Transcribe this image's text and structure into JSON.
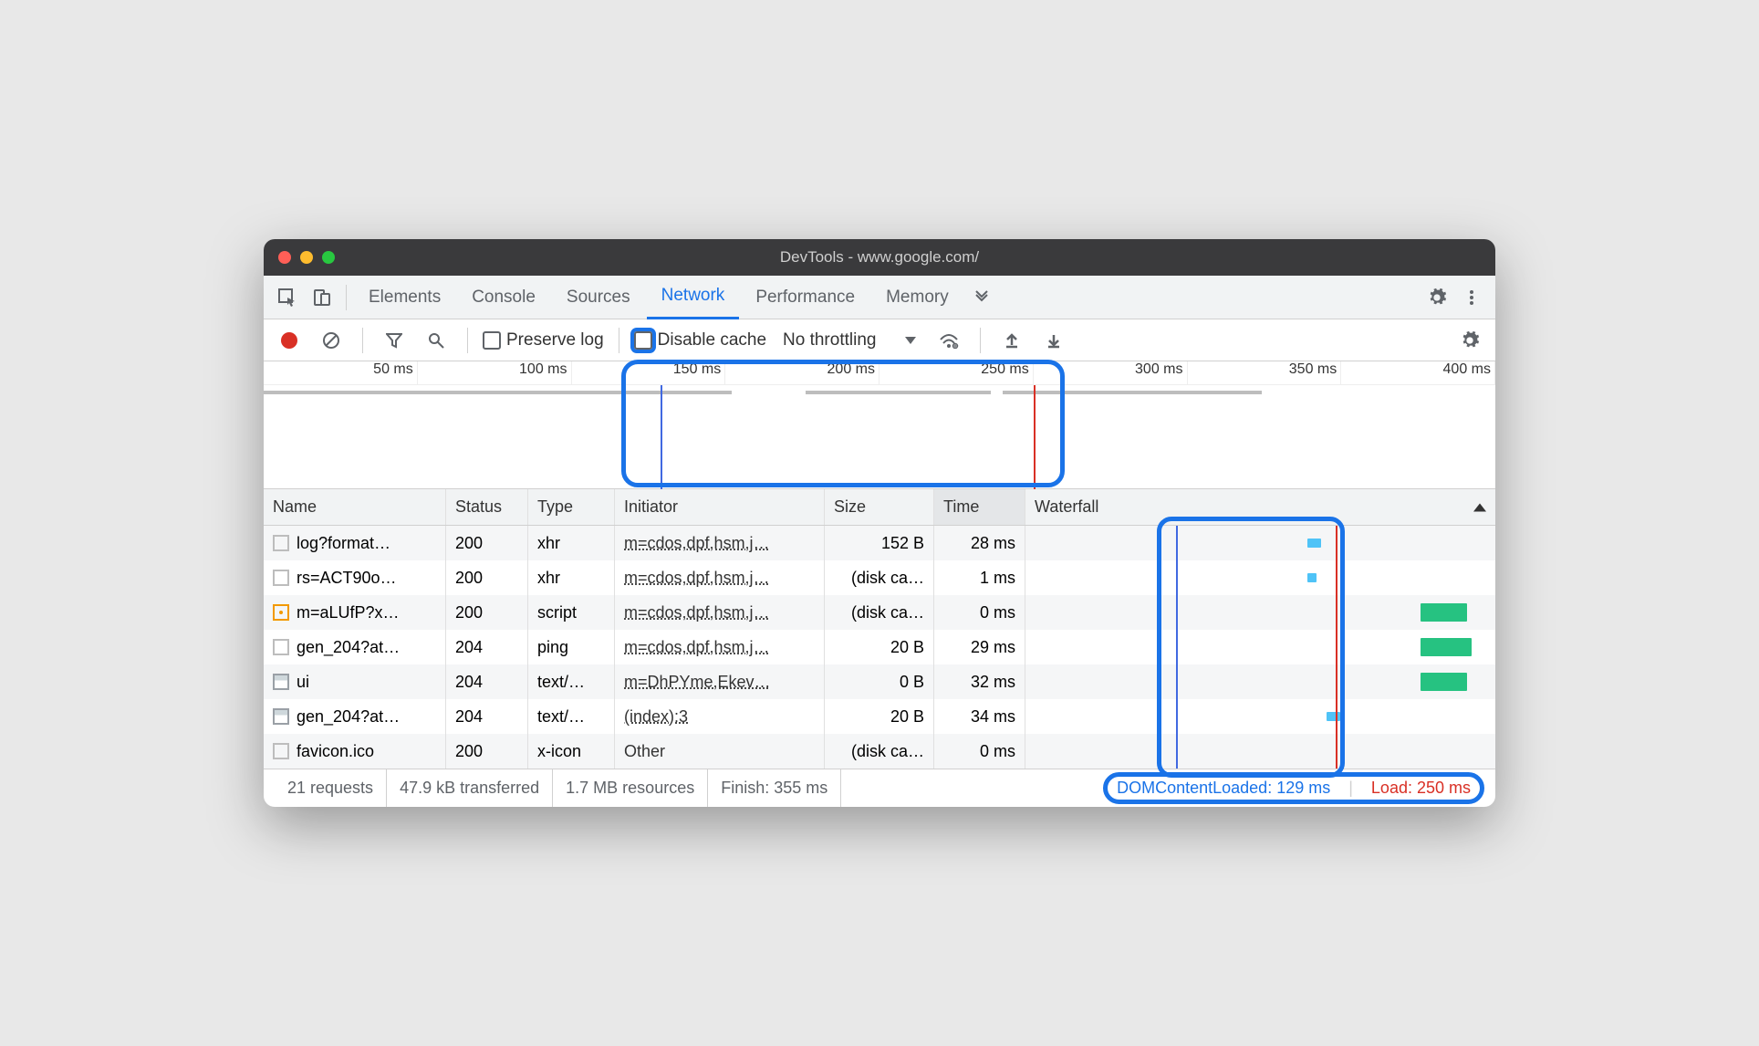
{
  "window": {
    "title": "DevTools - www.google.com/"
  },
  "tabs": [
    "Elements",
    "Console",
    "Sources",
    "Network",
    "Performance",
    "Memory"
  ],
  "activeTab": "Network",
  "toolbar": {
    "preserveLog": "Preserve log",
    "disableCache": "Disable cache",
    "throttling": "No throttling"
  },
  "timeline": {
    "ticks": [
      "50 ms",
      "100 ms",
      "150 ms",
      "200 ms",
      "250 ms",
      "300 ms",
      "350 ms",
      "400 ms"
    ]
  },
  "columns": {
    "name": "Name",
    "status": "Status",
    "type": "Type",
    "initiator": "Initiator",
    "size": "Size",
    "time": "Time",
    "waterfall": "Waterfall"
  },
  "rows": [
    {
      "name": "log?format…",
      "status": "200",
      "type": "xhr",
      "initiator": "m=cdos,dpf,hsm,j…",
      "size": "152 B",
      "time": "28 ms",
      "icon": "plain"
    },
    {
      "name": "rs=ACT90o…",
      "status": "200",
      "type": "xhr",
      "initiator": "m=cdos,dpf,hsm,j…",
      "size": "(disk ca…",
      "time": "1 ms",
      "icon": "plain"
    },
    {
      "name": "m=aLUfP?x…",
      "status": "200",
      "type": "script",
      "initiator": "m=cdos,dpf,hsm,j…",
      "size": "(disk ca…",
      "time": "0 ms",
      "icon": "script"
    },
    {
      "name": "gen_204?at…",
      "status": "204",
      "type": "ping",
      "initiator": "m=cdos,dpf,hsm,j…",
      "size": "20 B",
      "time": "29 ms",
      "icon": "plain"
    },
    {
      "name": "ui",
      "status": "204",
      "type": "text/…",
      "initiator": "m=DhPYme,Ekev…",
      "size": "0 B",
      "time": "32 ms",
      "icon": "doc"
    },
    {
      "name": "gen_204?at…",
      "status": "204",
      "type": "text/…",
      "initiator": "(index):3",
      "size": "20 B",
      "time": "34 ms",
      "icon": "doc"
    },
    {
      "name": "favicon.ico",
      "status": "200",
      "type": "x-icon",
      "initiator": "Other",
      "size": "(disk ca…",
      "time": "0 ms",
      "icon": "plain"
    }
  ],
  "status": {
    "requests": "21 requests",
    "transferred": "47.9 kB transferred",
    "resources": "1.7 MB resources",
    "finish": "Finish: 355 ms",
    "dcl": "DOMContentLoaded: 129 ms",
    "load": "Load: 250 ms"
  }
}
